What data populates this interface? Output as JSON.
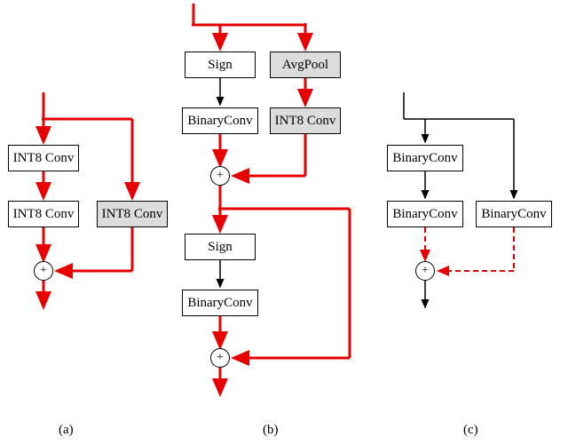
{
  "diagram_a": {
    "label": "(a)",
    "blocks": {
      "b1": "INT8 Conv",
      "b2": "INT8 Conv",
      "b3": "INT8 Conv"
    }
  },
  "diagram_b": {
    "label": "(b)",
    "blocks": {
      "sign1": "Sign",
      "bconv1": "BinaryConv",
      "avgpool": "AvgPool",
      "int8": "INT8 Conv",
      "sign2": "Sign",
      "bconv2": "BinaryConv"
    }
  },
  "diagram_c": {
    "label": "(c)",
    "blocks": {
      "bconv1": "BinaryConv",
      "bconv2": "BinaryConv",
      "bconv3": "BinaryConv"
    }
  },
  "sum_symbol": "+",
  "chart_data": {
    "type": "diagram",
    "description": "Three neural network block diagrams showing residual connections. Red solid arrows indicate INT8/full-precision data paths, black solid arrows indicate binary data paths, red dashed arrows indicate partial-precision paths.",
    "subfigures": [
      {
        "id": "a",
        "label": "(a)",
        "nodes": [
          "input",
          "INT8 Conv",
          "INT8 Conv",
          "INT8 Conv (shortcut, shaded)",
          "sum",
          "output"
        ],
        "edges": [
          {
            "from": "input",
            "to": "INT8 Conv #1",
            "style": "red-solid"
          },
          {
            "from": "input",
            "to": "INT8 Conv shortcut",
            "style": "red-solid"
          },
          {
            "from": "INT8 Conv #1",
            "to": "INT8 Conv #2",
            "style": "red-solid"
          },
          {
            "from": "INT8 Conv #2",
            "to": "sum",
            "style": "red-solid"
          },
          {
            "from": "INT8 Conv shortcut",
            "to": "sum",
            "style": "red-solid"
          },
          {
            "from": "sum",
            "to": "output",
            "style": "red-solid"
          }
        ]
      },
      {
        "id": "b",
        "label": "(b)",
        "nodes": [
          "input",
          "Sign #1",
          "BinaryConv #1",
          "AvgPool (shaded)",
          "INT8 Conv (shaded)",
          "sum #1",
          "Sign #2",
          "BinaryConv #2",
          "sum #2",
          "output"
        ],
        "edges": [
          {
            "from": "input",
            "to": "Sign #1",
            "style": "red-solid"
          },
          {
            "from": "input",
            "to": "AvgPool",
            "style": "red-solid"
          },
          {
            "from": "Sign #1",
            "to": "BinaryConv #1",
            "style": "black-solid"
          },
          {
            "from": "AvgPool",
            "to": "INT8 Conv",
            "style": "red-solid"
          },
          {
            "from": "BinaryConv #1",
            "to": "sum #1",
            "style": "red-solid"
          },
          {
            "from": "INT8 Conv",
            "to": "sum #1",
            "style": "red-solid"
          },
          {
            "from": "sum #1",
            "to": "Sign #2",
            "style": "red-solid"
          },
          {
            "from": "sum #1",
            "to": "sum #2",
            "style": "red-solid",
            "note": "skip"
          },
          {
            "from": "Sign #2",
            "to": "BinaryConv #2",
            "style": "black-solid"
          },
          {
            "from": "BinaryConv #2",
            "to": "sum #2",
            "style": "red-solid"
          },
          {
            "from": "sum #2",
            "to": "output",
            "style": "red-solid"
          }
        ]
      },
      {
        "id": "c",
        "label": "(c)",
        "nodes": [
          "input",
          "BinaryConv #1",
          "BinaryConv #2",
          "BinaryConv (shortcut)",
          "sum",
          "output"
        ],
        "edges": [
          {
            "from": "input",
            "to": "BinaryConv #1",
            "style": "black-solid"
          },
          {
            "from": "input",
            "to": "BinaryConv shortcut",
            "style": "black-solid"
          },
          {
            "from": "BinaryConv #1",
            "to": "BinaryConv #2",
            "style": "black-solid"
          },
          {
            "from": "BinaryConv #2",
            "to": "sum",
            "style": "red-dashed"
          },
          {
            "from": "BinaryConv shortcut",
            "to": "sum",
            "style": "red-dashed"
          },
          {
            "from": "sum",
            "to": "output",
            "style": "black-solid"
          }
        ]
      }
    ]
  }
}
